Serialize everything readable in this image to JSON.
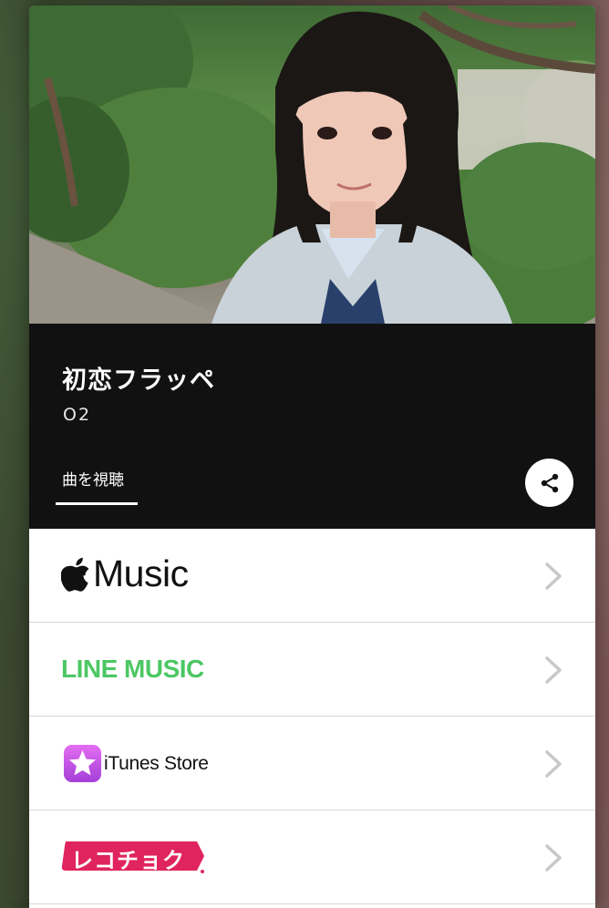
{
  "song": {
    "title": "初恋フラッペ",
    "artist": "O2"
  },
  "tabs": [
    {
      "label": "曲を視聴",
      "active": true
    }
  ],
  "share": {
    "icon": "share-icon"
  },
  "services": [
    {
      "name": "Apple Music",
      "logo_text": "Music",
      "icon": "apple-icon",
      "color": "#111111"
    },
    {
      "name": "LINE MUSIC",
      "logo_text": "LINE MUSIC",
      "color": "#4cc764"
    },
    {
      "name": "iTunes Store",
      "logo_text": "iTunes Store",
      "icon": "star-icon",
      "color": "#c95be0"
    },
    {
      "name": "レコチョク",
      "logo_text": "レコチョク",
      "color": "#e0245e"
    }
  ],
  "colors": {
    "header_bg": "#111111",
    "line_green": "#4cc764",
    "recochoku_pink": "#e0245e",
    "chevron": "#c8c8c8"
  }
}
